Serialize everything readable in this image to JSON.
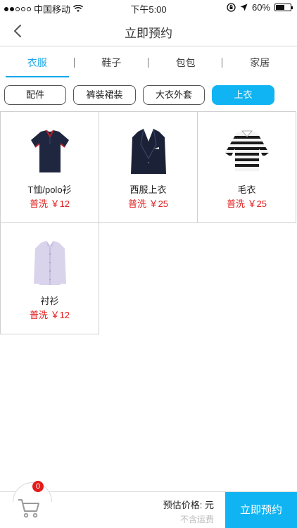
{
  "status_bar": {
    "carrier": "中国移动",
    "time": "下午5:00",
    "battery": "60%",
    "battery_level": 0.6
  },
  "nav": {
    "title": "立即预约"
  },
  "tabs": [
    {
      "label": "衣服",
      "active": true
    },
    {
      "label": "鞋子",
      "active": false
    },
    {
      "label": "包包",
      "active": false
    },
    {
      "label": "家居",
      "active": false
    }
  ],
  "chips": [
    {
      "label": "配件",
      "active": false
    },
    {
      "label": "裤装裙装",
      "active": false
    },
    {
      "label": "大衣外套",
      "active": false
    },
    {
      "label": "上衣",
      "active": true
    }
  ],
  "items": [
    {
      "name": "T恤/polo衫",
      "price": "普洗 ￥12",
      "icon": "polo-shirt-icon"
    },
    {
      "name": "西服上衣",
      "price": "普洗 ￥25",
      "icon": "suit-jacket-icon"
    },
    {
      "name": "毛衣",
      "price": "普洗 ￥25",
      "icon": "sweater-icon"
    },
    {
      "name": "衬衫",
      "price": "普洗 ￥12",
      "icon": "dress-shirt-icon"
    }
  ],
  "bottom_bar": {
    "cart_count": "0",
    "estimate_label": "预估价格: 元",
    "shipping_note": "不含运费",
    "submit_label": "立即预约"
  },
  "colors": {
    "accent": "#11b4f2",
    "price": "#e21b1b"
  }
}
